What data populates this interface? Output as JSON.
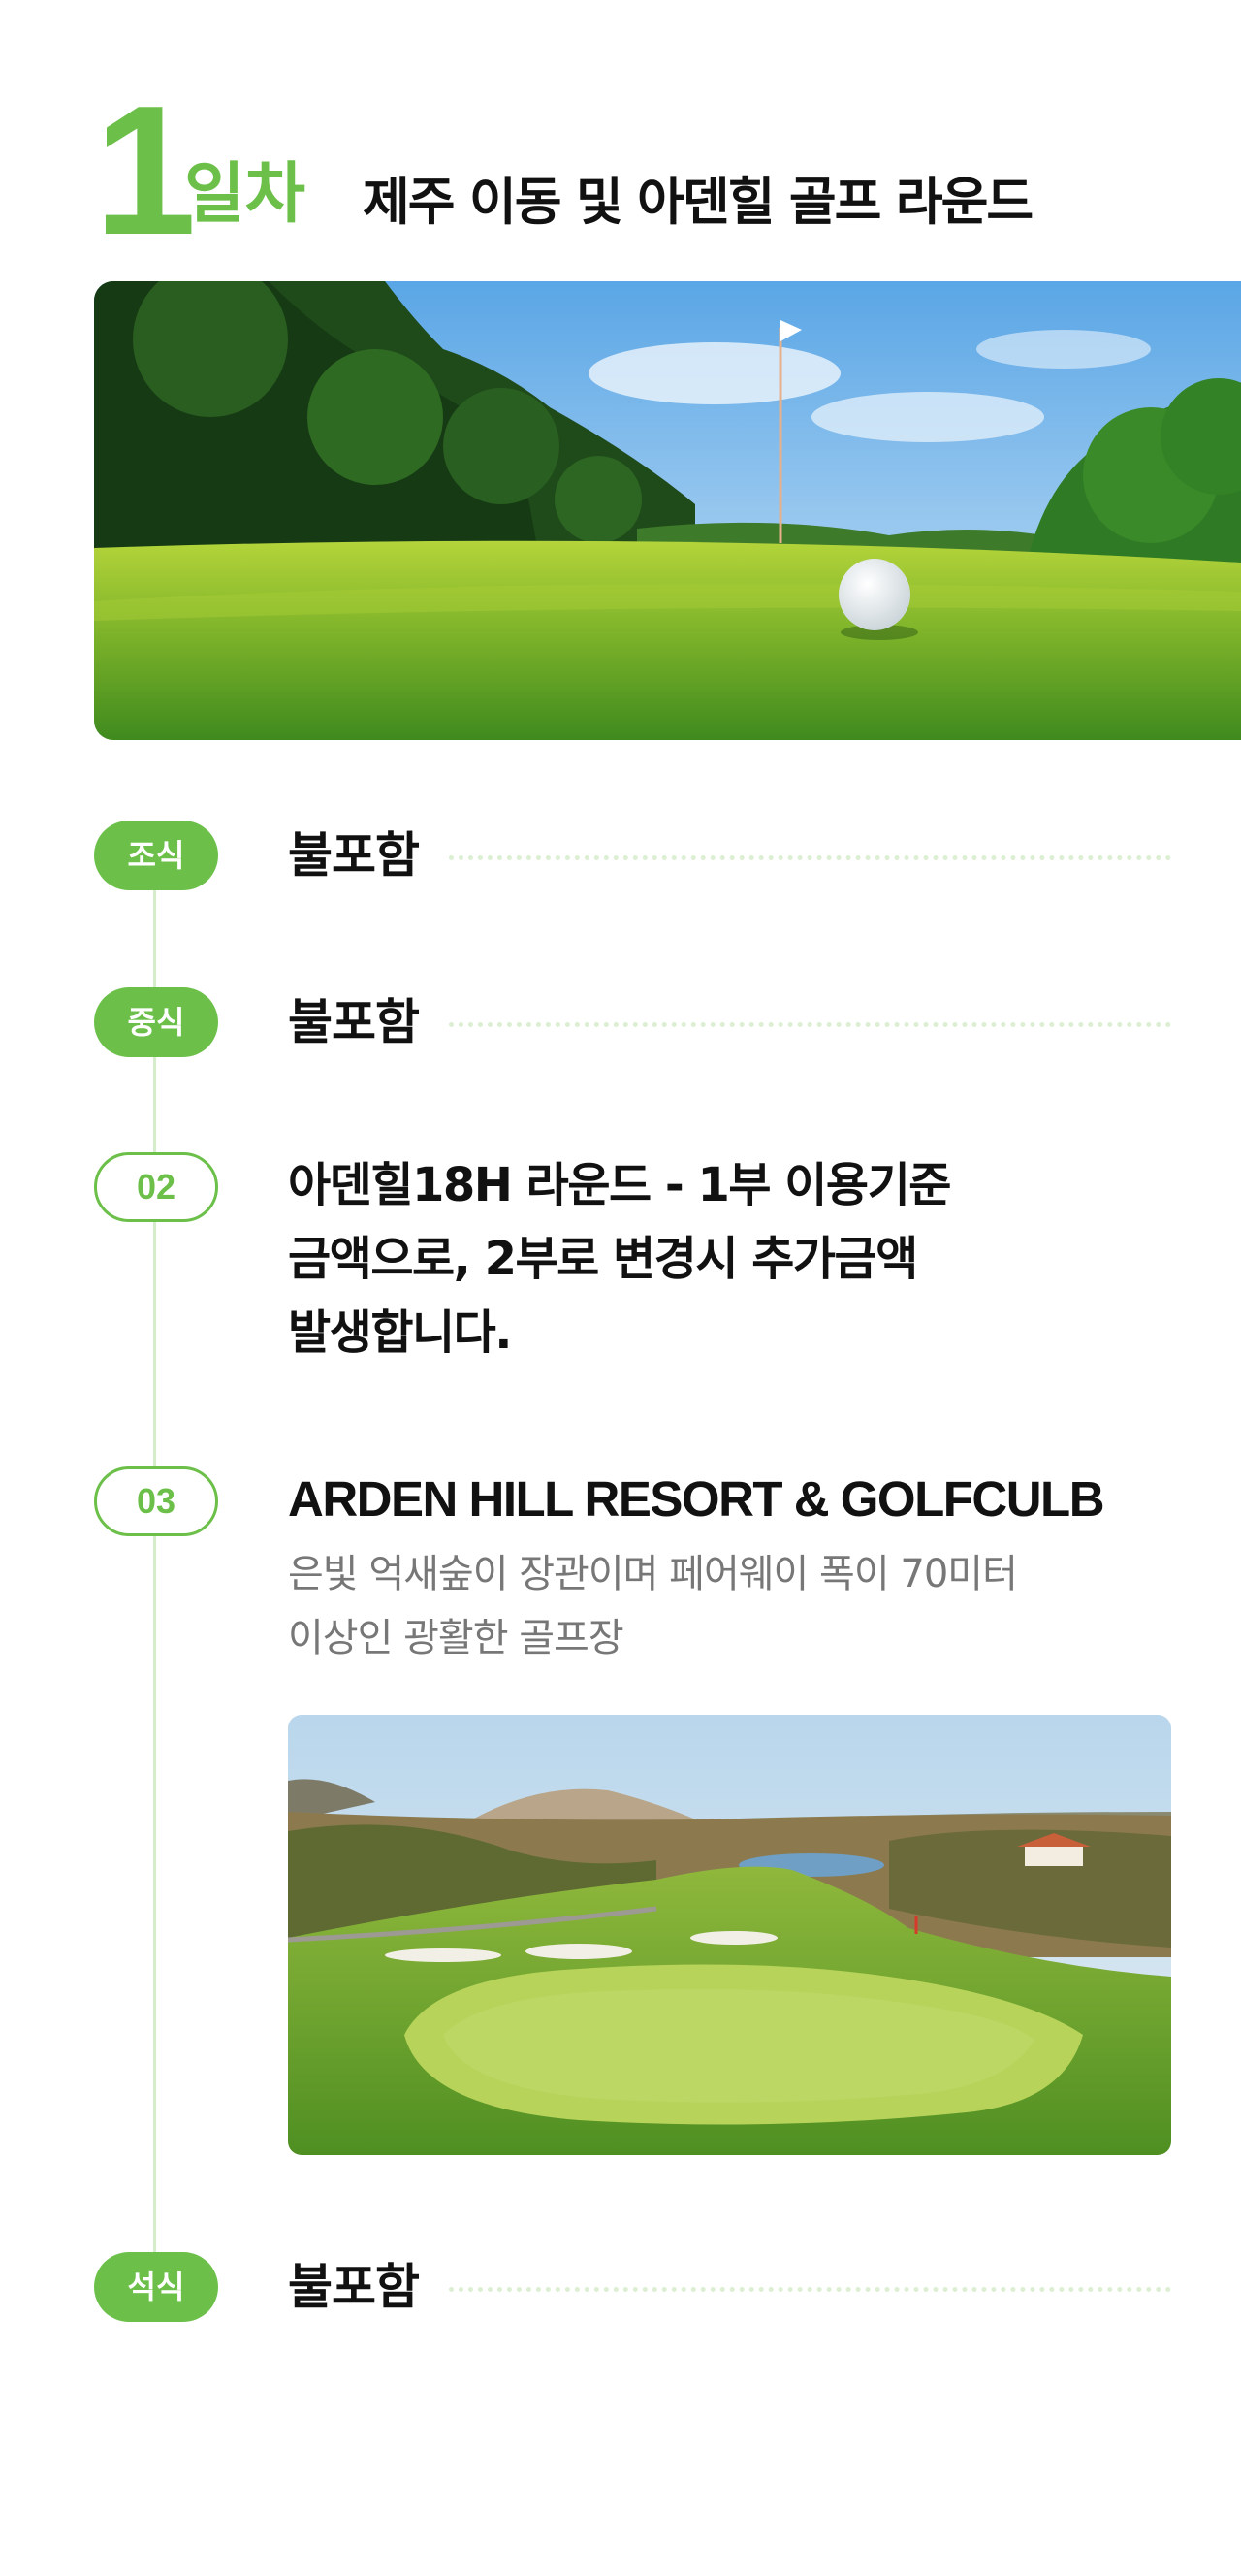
{
  "header": {
    "day_number": "1",
    "day_suffix": "일차",
    "title": "제주 이동 및 아덴힐 골프 라운드"
  },
  "images": {
    "hero": "golf-ball-on-green-photo",
    "course": "arden-hill-golf-course-photo"
  },
  "itinerary": {
    "breakfast": {
      "badge": "조식",
      "text": "불포함"
    },
    "lunch": {
      "badge": "중식",
      "text": "불포함"
    },
    "step2": {
      "badge": "02",
      "line1": "아덴힐18H 라운드 - 1부 이용기준",
      "line2": "금액으로, 2부로 변경시 추가금액",
      "line3": "발생합니다."
    },
    "step3": {
      "badge": "03",
      "title": "ARDEN HILL RESORT & GOLFCULB",
      "desc_line1": "은빛 억새숲이 장관이며 페어웨이 폭이 70미터",
      "desc_line2": "이상인 광활한 골프장"
    },
    "dinner": {
      "badge": "석식",
      "text": "불포함"
    }
  },
  "colors": {
    "accent": "#6cc04a",
    "timeline": "#d6edcc",
    "muted_text": "#777777"
  }
}
